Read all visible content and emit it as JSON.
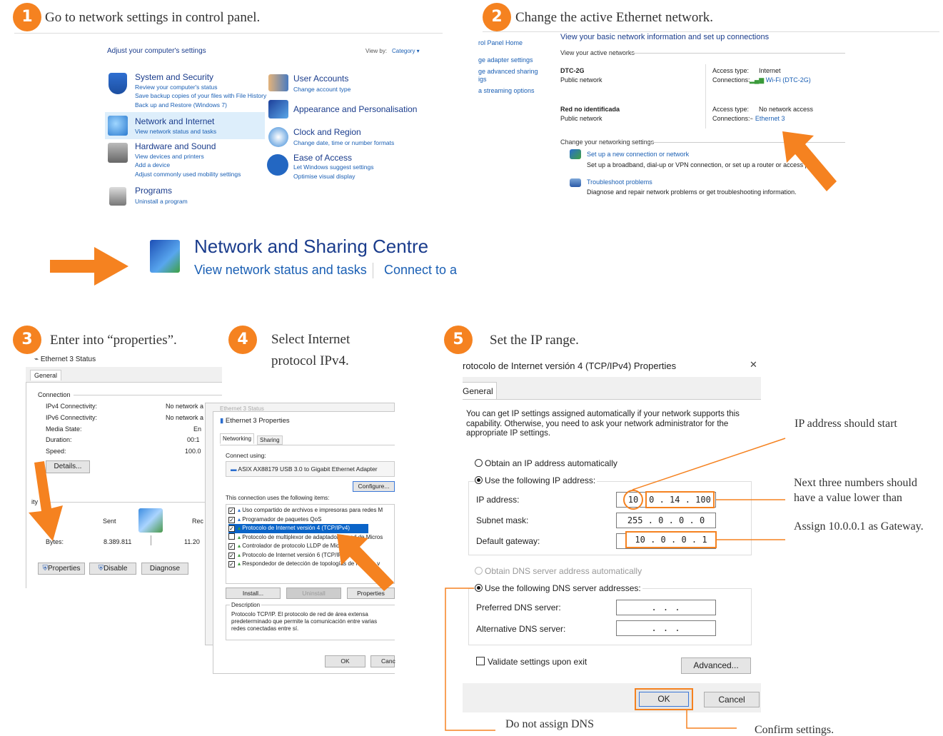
{
  "steps": {
    "s1": {
      "num": "1",
      "text": "Go to network settings in control panel."
    },
    "s2": {
      "num": "2",
      "text": "Change the active Ethernet network."
    },
    "s3": {
      "num": "3",
      "text": "Enter into “properties”."
    },
    "s4": {
      "num": "4",
      "line1": "Select Internet",
      "line2": "protocol IPv4."
    },
    "s5": {
      "num": "5",
      "text": "Set the IP range."
    }
  },
  "cp": {
    "title": "Adjust your computer's settings",
    "viewby": "View by:",
    "viewby_value": "Category ▾",
    "categories": [
      {
        "name": "System and Security",
        "subs": [
          "Review your computer's status",
          "Save backup copies of your files with File History",
          "Back up and Restore (Windows 7)"
        ]
      },
      {
        "name": "Network and Internet",
        "subs": [
          "View network status and tasks"
        ]
      },
      {
        "name": "Hardware and Sound",
        "subs": [
          "View devices and printers",
          "Add a device",
          "Adjust commonly used mobility settings"
        ]
      },
      {
        "name": "Programs",
        "subs": [
          "Uninstall a program"
        ]
      },
      {
        "name": "User Accounts",
        "subs": [
          "Change account type"
        ]
      },
      {
        "name": "Appearance and Personalisation",
        "subs": []
      },
      {
        "name": "Clock and Region",
        "subs": [
          "Change date, time or number formats"
        ]
      },
      {
        "name": "Ease of Access",
        "subs": [
          "Let Windows suggest settings",
          "Optimise visual display"
        ]
      }
    ]
  },
  "nsc": {
    "title": "Network and Sharing Centre",
    "link1": "View network status and tasks",
    "link2": "Connect to a r"
  },
  "ns": {
    "sidebar": [
      "rol Panel Home",
      "ge adapter settings",
      "ge advanced sharing",
      "igs",
      "a streaming options"
    ],
    "title": "View your basic network information and set up connections",
    "active": "View your active networks",
    "net1": {
      "name": "DTC-2G",
      "type": "Public network",
      "access_label": "Access type:",
      "access": "Internet",
      "conn_label": "Connections:",
      "conn": "Wi-Fi (DTC-2G)"
    },
    "net2": {
      "name": "Red no identificada",
      "type": "Public network",
      "access_label": "Access type:",
      "access": "No network access",
      "conn_label": "Connections:",
      "conn": "Ethernet 3"
    },
    "change": "Change your networking settings",
    "opt1": {
      "title": "Set up a new connection or network",
      "desc": "Set up a broadband, dial-up or VPN connection, or set up a router or access point."
    },
    "opt2": {
      "title": "Troubleshoot problems",
      "desc": "Diagnose and repair network problems or get troubleshooting information."
    }
  },
  "status": {
    "title": "Ethernet 3 Status",
    "tab": "General",
    "connection": "Connection",
    "rows": [
      [
        "IPv4 Connectivity:",
        "No network a"
      ],
      [
        "IPv6 Connectivity:",
        "No network a"
      ],
      [
        "Media State:",
        "En"
      ],
      [
        "Duration:",
        "00:1"
      ],
      [
        "Speed:",
        "100.0"
      ]
    ],
    "details": "Details...",
    "activity": "ity",
    "sent": "Sent",
    "received": "Rec",
    "bytes": "Bytes:",
    "sent_val": "8.389.811",
    "recv_val": "11.20",
    "b_props": "Properties",
    "b_disable": "Disable",
    "b_diag": "Diagnose"
  },
  "props": {
    "behind_title": "Ethernet 3 Status",
    "title": "Ethernet 3 Properties",
    "tab1": "Networking",
    "tab2": "Sharing",
    "connect_using": "Connect using:",
    "adapter": "ASIX AX88179 USB 3.0 to Gigabit Ethernet Adapter",
    "configure": "Configure...",
    "uses": "This connection uses the following items:",
    "items": [
      "Uso compartido de archivos e impresoras para redes M",
      "Programador de paquetes QoS",
      "Protocolo de Internet versión 4 (TCP/IPv4)",
      "Protocolo de multiplexor de adaptador de red de Micros",
      "Controlador de protocolo LLDP de Microsoft",
      "Protocolo de Internet versión 6 (TCP/IPv6)",
      "Respondedor de detección de topologías de nivel de v"
    ],
    "checked": [
      true,
      true,
      true,
      false,
      true,
      true,
      true
    ],
    "install": "Install...",
    "uninstall": "Uninstall",
    "properties": "Properties",
    "description": "Description",
    "desc_text": "Protocolo TCP/IP. El protocolo de red de área extensa predeterminado que permite la comunicación entre varias redes conectadas entre sí.",
    "ok": "OK",
    "cancel": "Canc"
  },
  "ipv4": {
    "title": "rotocolo de Internet versión 4 (TCP/IPv4) Properties",
    "close": "✕",
    "tab": "General",
    "intro": "You can get IP settings assigned automatically if your network supports this capability. Otherwise, you need to ask your network administrator for the appropriate IP settings.",
    "auto_ip": "Obtain an IP address automatically",
    "use_ip": "Use the following IP address:",
    "ip_label": "IP address:",
    "ip_first": "10",
    "ip_rest": "0  .  14  .  100",
    "mask_label": "Subnet mask:",
    "mask": "255  .  0  .  0  .  0",
    "gw_label": "Default gateway:",
    "gw": "10  .  0  .  0  .  1",
    "auto_dns": "Obtain DNS server address automatically",
    "use_dns": "Use the following DNS server addresses:",
    "pref": "Preferred DNS server:",
    "alt": "Alternative DNS server:",
    "dns_blank": ".      .      .",
    "validate": "Validate settings upon exit",
    "advanced": "Advanced...",
    "ok": "OK",
    "cancel": "Cancel"
  },
  "annotations": {
    "a1": "IP address should start",
    "a2a": "Next three numbers should",
    "a2b": "have a value lower than",
    "a3": "Assign 10.0.0.1 as Gateway.",
    "a4": "Do not assign DNS",
    "a5": "Confirm settings."
  },
  "colors": {
    "accent": "#f58220",
    "link": "#1a5fb4"
  }
}
